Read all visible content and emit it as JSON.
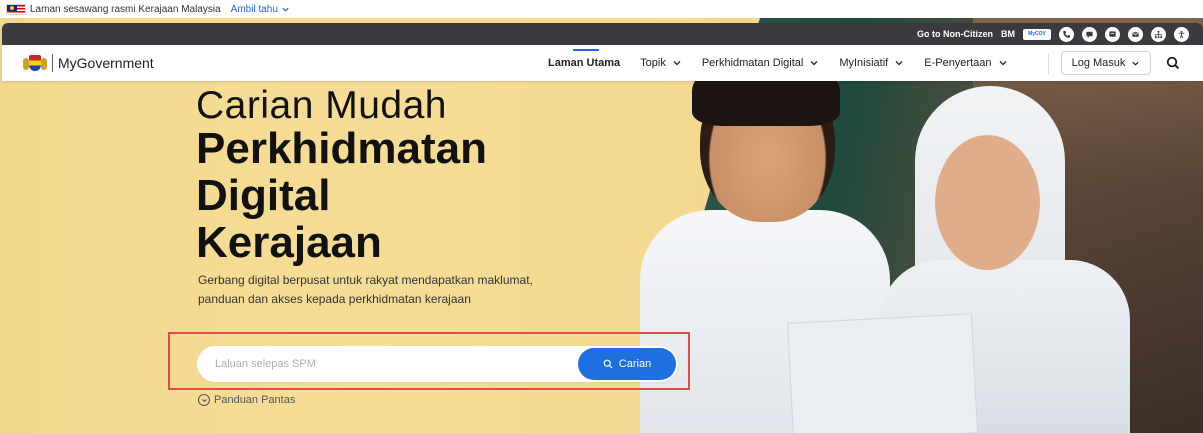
{
  "official_strip": {
    "text": "Laman sesawang rasmi Kerajaan Malaysia",
    "ambil_label": "Ambil tahu"
  },
  "util_bar": {
    "non_citizen_label": "Go to Non-Citizen",
    "language_label": "BM",
    "mycov_label": "MyCOV",
    "icons": [
      "phone-icon",
      "chat-icon",
      "feedback-icon",
      "mail-icon",
      "sitemap-icon",
      "accessibility-icon"
    ]
  },
  "nav": {
    "logo_text": "MyGovernment",
    "items": [
      {
        "label": "Laman Utama",
        "active": true
      },
      {
        "label": "Topik"
      },
      {
        "label": "Perkhidmatan Digital"
      },
      {
        "label": "MyInisiatif"
      },
      {
        "label": "E-Penyertaan"
      }
    ],
    "login_label": "Log Masuk"
  },
  "hero": {
    "title_light": "Carian Mudah",
    "title_bold": [
      "Perkhidmatan",
      "Digital",
      "Kerajaan"
    ],
    "subtitle": "Gerbang digital berpusat untuk rakyat mendapatkan maklumat, panduan dan akses kepada perkhidmatan kerajaan",
    "search_placeholder": "Laluan selepas SPM",
    "search_button": "Carian",
    "quick_guide": "Panduan Pantas"
  },
  "colors": {
    "accent": "#1f6fe0",
    "hero_bg": "#f4d990",
    "util_bar": "#3a3b3f",
    "highlight": "#e24b4b"
  }
}
